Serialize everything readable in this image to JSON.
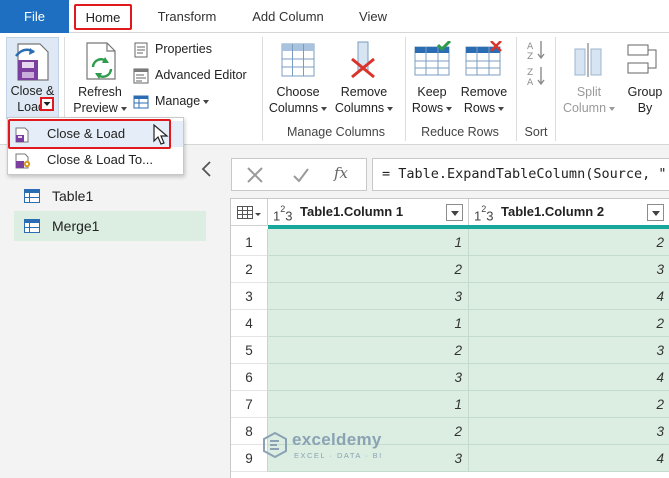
{
  "tabs": {
    "file": "File",
    "home": "Home",
    "transform": "Transform",
    "add_column": "Add Column",
    "view": "View"
  },
  "ribbon": {
    "close_load": {
      "line1": "Close &",
      "line2": "Load"
    },
    "refresh_preview": {
      "line1": "Refresh",
      "line2": "Preview"
    },
    "properties": "Properties",
    "advanced_editor": "Advanced Editor",
    "manage": "Manage",
    "choose_columns": {
      "line1": "Choose",
      "line2": "Columns"
    },
    "remove_columns": {
      "line1": "Remove",
      "line2": "Columns"
    },
    "keep_rows": {
      "line1": "Keep",
      "line2": "Rows"
    },
    "remove_rows": {
      "line1": "Remove",
      "line2": "Rows"
    },
    "split_column": {
      "line1": "Split",
      "line2": "Column"
    },
    "group_by": {
      "line1": "Group",
      "line2": "By"
    },
    "groups": {
      "manage_columns": "Manage Columns",
      "reduce_rows": "Reduce Rows",
      "sort": "Sort"
    }
  },
  "dropdown": {
    "items": [
      {
        "label": "Close & Load"
      },
      {
        "label": "Close & Load To..."
      }
    ]
  },
  "queries": [
    {
      "label": "Table1"
    },
    {
      "label": "Merge1"
    }
  ],
  "formula_bar": {
    "formula": "= Table.ExpandTableColumn(Source, \""
  },
  "table": {
    "type_icon": "1²3",
    "columns": [
      "Table1.Column 1",
      "Table1.Column 2"
    ],
    "rows": [
      {
        "n": "1",
        "c1": "1",
        "c2": "2"
      },
      {
        "n": "2",
        "c1": "2",
        "c2": "3"
      },
      {
        "n": "3",
        "c1": "3",
        "c2": "4"
      },
      {
        "n": "4",
        "c1": "1",
        "c2": "2"
      },
      {
        "n": "5",
        "c1": "2",
        "c2": "3"
      },
      {
        "n": "6",
        "c1": "3",
        "c2": "4"
      },
      {
        "n": "7",
        "c1": "1",
        "c2": "2"
      },
      {
        "n": "8",
        "c1": "2",
        "c2": "3"
      },
      {
        "n": "9",
        "c1": "3",
        "c2": "4"
      }
    ]
  },
  "watermark": {
    "name": "exceldemy",
    "sub": "EXCEL · DATA · BI"
  },
  "colors": {
    "file_tab": "#1e6fc1",
    "highlight_red": "#e0191f",
    "teal_accent": "#17a79b",
    "cell_fill": "#dbeee1"
  }
}
